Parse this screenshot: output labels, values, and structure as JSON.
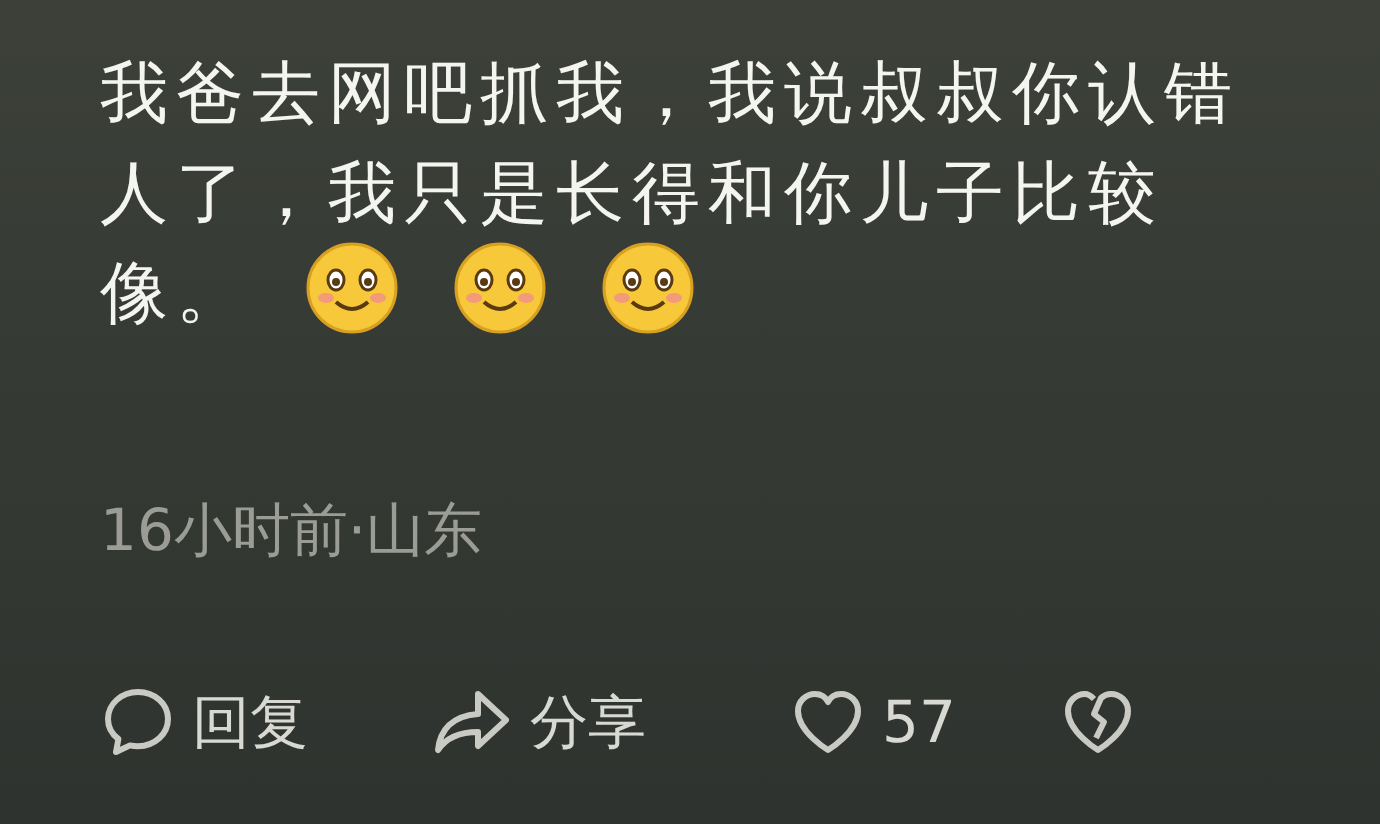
{
  "comment": {
    "text": [
      "我爸去网吧抓我，我说叔叔你认错人了，我只是长得和你儿子比较",
      "像。"
    ],
    "emojis": [
      {
        "kind": "smile"
      },
      {
        "kind": "smile"
      },
      {
        "kind": "smile"
      }
    ],
    "meta": "16小时前·山东"
  },
  "actions": [
    {
      "kind": "reply",
      "label": "回复"
    },
    {
      "kind": "share",
      "label": "分享"
    },
    {
      "kind": "like",
      "label": "57"
    },
    {
      "kind": "dislike"
    }
  ]
}
